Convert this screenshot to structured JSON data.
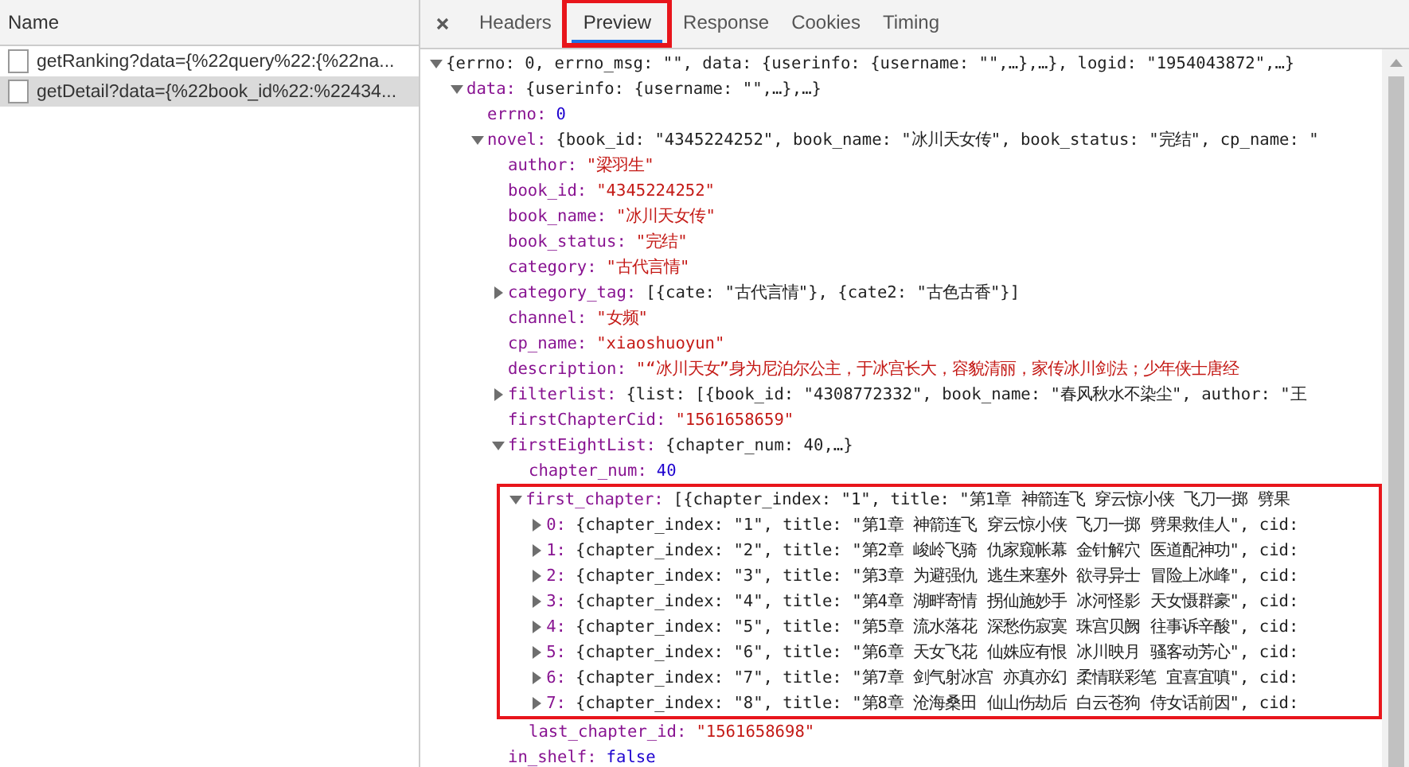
{
  "requests": {
    "column": "Name",
    "items": [
      {
        "name": "getRanking?data={%22query%22:{%22na...",
        "selected": false
      },
      {
        "name": "getDetail?data={%22book_id%22:%22434...",
        "selected": true
      }
    ]
  },
  "tabs": [
    {
      "label": "Headers",
      "selected": false,
      "highlighted": false
    },
    {
      "label": "Preview",
      "selected": true,
      "highlighted": true
    },
    {
      "label": "Response",
      "selected": false,
      "highlighted": false
    },
    {
      "label": "Cookies",
      "selected": false,
      "highlighted": false
    },
    {
      "label": "Timing",
      "selected": false,
      "highlighted": false
    }
  ],
  "preview": {
    "tree": [
      {
        "value": "{errno: 0, errno_msg: \"\", data: {userinfo: {username: \"\",…},…}, logid: \"1954043872\",…}",
        "kind": "summary",
        "expanded": true,
        "children": [
          {
            "key": "data:",
            "value": "{userinfo: {username: \"\",…},…}",
            "kind": "summary",
            "expanded": true,
            "children": [
              {
                "key": "errno:",
                "value": "0",
                "kind": "number"
              },
              {
                "key": "novel:",
                "value": "{book_id: \"4345224252\", book_name: \"冰川天女传\", book_status: \"完结\", cp_name: \"",
                "kind": "summary",
                "expanded": true,
                "children": [
                  {
                    "key": "author:",
                    "value": "\"梁羽生\"",
                    "kind": "string"
                  },
                  {
                    "key": "book_id:",
                    "value": "\"4345224252\"",
                    "kind": "string"
                  },
                  {
                    "key": "book_name:",
                    "value": "\"冰川天女传\"",
                    "kind": "string"
                  },
                  {
                    "key": "book_status:",
                    "value": "\"完结\"",
                    "kind": "string"
                  },
                  {
                    "key": "category:",
                    "value": "\"古代言情\"",
                    "kind": "string"
                  },
                  {
                    "key": "category_tag:",
                    "value": "[{cate: \"古代言情\"}, {cate2: \"古色古香\"}]",
                    "kind": "summary",
                    "expanded": false
                  },
                  {
                    "key": "channel:",
                    "value": "\"女频\"",
                    "kind": "string"
                  },
                  {
                    "key": "cp_name:",
                    "value": "\"xiaoshuoyun\"",
                    "kind": "string"
                  },
                  {
                    "key": "description:",
                    "value": "\"“冰川天女”身为尼泊尔公主，于冰宫长大，容貌清丽，家传冰川剑法；少年侠士唐经",
                    "kind": "string"
                  },
                  {
                    "key": "filterlist:",
                    "value": "{list: [{book_id: \"4308772332\", book_name: \"春风秋水不染尘\", author: \"王",
                    "kind": "summary",
                    "expanded": false
                  },
                  {
                    "key": "firstChapterCid:",
                    "value": "\"1561658659\"",
                    "kind": "string"
                  },
                  {
                    "key": "firstEightList:",
                    "value": "{chapter_num: 40,…}",
                    "kind": "summary",
                    "expanded": true,
                    "children": [
                      {
                        "key": "chapter_num:",
                        "value": "40",
                        "kind": "number"
                      },
                      {
                        "key": "first_chapter:",
                        "value": "[{chapter_index: \"1\", title: \"第1章 神箭连飞 穿云惊小侠 飞刀一掷 劈果",
                        "kind": "summary",
                        "expanded": true,
                        "highlighted": true,
                        "children": [
                          {
                            "key": "0:",
                            "value": "{chapter_index: \"1\", title: \"第1章 神箭连飞 穿云惊小侠 飞刀一掷 劈果救佳人\", cid:",
                            "kind": "summary",
                            "expanded": false
                          },
                          {
                            "key": "1:",
                            "value": "{chapter_index: \"2\", title: \"第2章 峻岭飞骑 仇家窥帐幕 金针解穴 医道配神功\", cid:",
                            "kind": "summary",
                            "expanded": false
                          },
                          {
                            "key": "2:",
                            "value": "{chapter_index: \"3\", title: \"第3章 为避强仇 逃生来塞外 欲寻异士 冒险上冰峰\", cid:",
                            "kind": "summary",
                            "expanded": false
                          },
                          {
                            "key": "3:",
                            "value": "{chapter_index: \"4\", title: \"第4章 湖畔寄情 拐仙施妙手 冰河怪影 天女慑群豪\", cid:",
                            "kind": "summary",
                            "expanded": false
                          },
                          {
                            "key": "4:",
                            "value": "{chapter_index: \"5\", title: \"第5章 流水落花 深愁伤寂寞 珠宫贝阙 往事诉辛酸\", cid:",
                            "kind": "summary",
                            "expanded": false
                          },
                          {
                            "key": "5:",
                            "value": "{chapter_index: \"6\", title: \"第6章 天女飞花 仙姝应有恨 冰川映月 骚客动芳心\", cid:",
                            "kind": "summary",
                            "expanded": false
                          },
                          {
                            "key": "6:",
                            "value": "{chapter_index: \"7\", title: \"第7章 剑气射冰宫 亦真亦幻 柔情联彩笔 宜喜宜嗔\", cid:",
                            "kind": "summary",
                            "expanded": false
                          },
                          {
                            "key": "7:",
                            "value": "{chapter_index: \"8\", title: \"第8章 沧海桑田 仙山伤劫后 白云苍狗 侍女话前因\", cid:",
                            "kind": "summary",
                            "expanded": false
                          }
                        ]
                      },
                      {
                        "key": "last_chapter_id:",
                        "value": "\"1561658698\"",
                        "kind": "string"
                      }
                    ]
                  },
                  {
                    "key": "in_shelf:",
                    "value": "false",
                    "kind": "bool"
                  }
                ]
              }
            ]
          }
        ]
      }
    ]
  }
}
